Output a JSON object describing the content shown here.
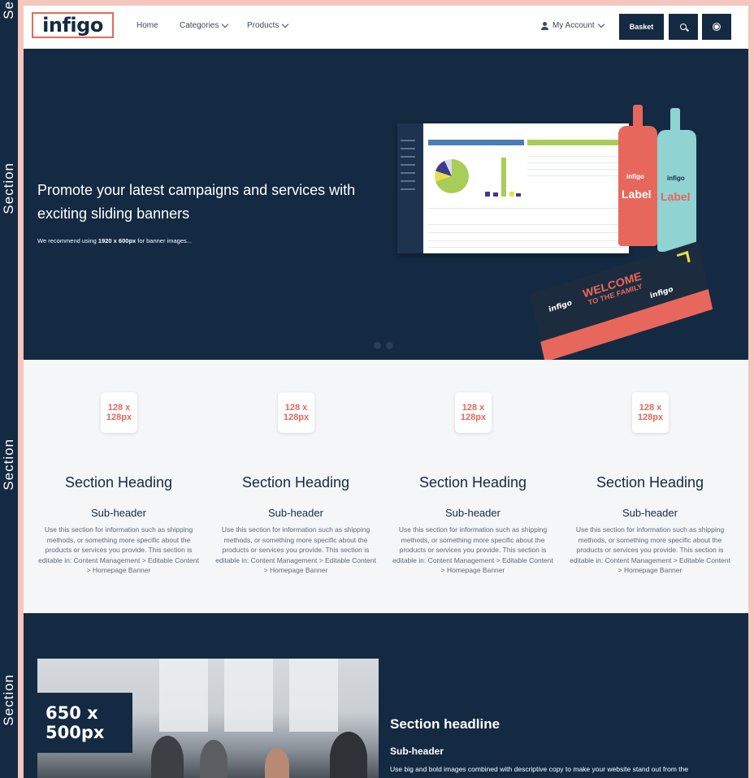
{
  "ribbon": {
    "labels": [
      "Section",
      "Section",
      "Section",
      "Section"
    ]
  },
  "header": {
    "logo_text": "infigo",
    "nav": [
      {
        "label": "Home",
        "has_dropdown": false
      },
      {
        "label": "Categories",
        "has_dropdown": true
      },
      {
        "label": "Products",
        "has_dropdown": true
      }
    ],
    "account_label": "My Account",
    "basket_label": "Basket",
    "search_icon": "search-icon",
    "settings_icon": "gear-icon"
  },
  "hero": {
    "title": "Promote your latest campaigns and services with exciting sliding banners",
    "note_prefix": "We recommend using ",
    "note_size": "1920 x 600px",
    "note_suffix": " for banner images...",
    "slide_count": 2,
    "bottle_label": "Label",
    "bottle_brand": "infigo",
    "box_welcome": "WELCOME",
    "box_family": "TO THE FAMILY",
    "box_brand": "infigo"
  },
  "features": [
    {
      "image_label": "128 x 128px",
      "heading": "Section Heading",
      "subheader": "Sub-header",
      "body": "Use this section for information such as shipping methods, or something more specific about the products or services you provide. This section is editable in: Content Management > Editable Content > Homepage Banner"
    },
    {
      "image_label": "128 x 128px",
      "heading": "Section Heading",
      "subheader": "Sub-header",
      "body": "Use this section for information such as shipping methods, or something more specific about the products or services you provide. This section is editable in: Content Management > Editable Content > Homepage Banner"
    },
    {
      "image_label": "128 x 128px",
      "heading": "Section Heading",
      "subheader": "Sub-header",
      "body": "Use this section for information such as shipping methods, or something more specific about the products or services you provide. This section is editable in: Content Management > Editable Content > Homepage Banner"
    },
    {
      "image_label": "128 x 128px",
      "heading": "Section Heading",
      "subheader": "Sub-header",
      "body": "Use this section for information such as shipping methods, or something more specific about the products or services you provide. This section is editable in: Content Management > Editable Content > Homepage Banner"
    }
  ],
  "lower": {
    "image_label": "650 x 500px",
    "headline": "Section headline",
    "subheader": "Sub-header",
    "body": "Use big and bold images combined with descriptive copy to make your website stand out from the"
  },
  "colors": {
    "navy": "#142a42",
    "coral": "#e8675c",
    "frame": "#f4c6bd",
    "light_bg": "#f4f6f8"
  }
}
